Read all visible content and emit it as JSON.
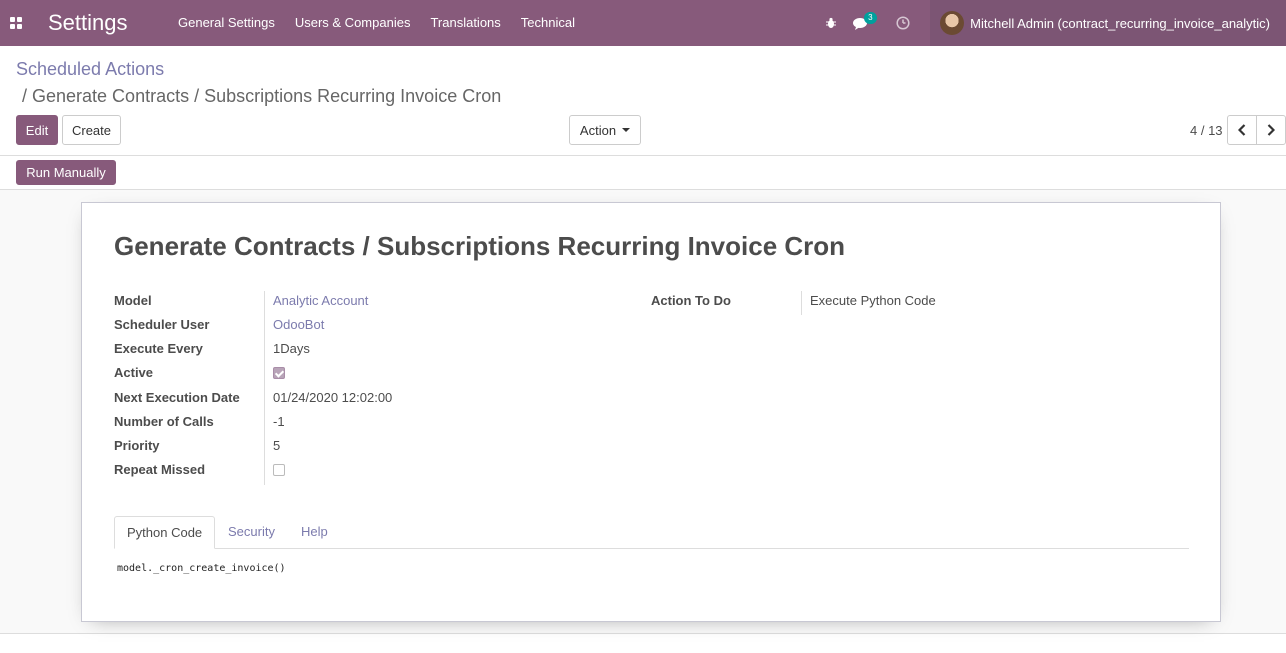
{
  "navbar": {
    "app_title": "Settings",
    "menu": [
      "General Settings",
      "Users & Companies",
      "Translations",
      "Technical"
    ],
    "icons": [
      "apps-icon",
      "bug-icon",
      "chat-icon",
      "clock-icon"
    ],
    "messages_badge": "3",
    "user_name": "Mitchell Admin (contract_recurring_invoice_analytic)",
    "color": "#875a7b"
  },
  "breadcrumb": {
    "parent": "Scheduled Actions",
    "current": "/ Generate Contracts / Subscriptions Recurring Invoice Cron"
  },
  "toolbar": {
    "edit_label": "Edit",
    "create_label": "Create",
    "action_label": "Action",
    "pager": "4 / 13"
  },
  "statusbar": {
    "run_manually_label": "Run Manually"
  },
  "record": {
    "title": "Generate Contracts / Subscriptions Recurring Invoice Cron",
    "fields_left": [
      {
        "label": "Model",
        "value": "Analytic Account",
        "type": "link"
      },
      {
        "label": "Scheduler User",
        "value": "OdooBot",
        "type": "link"
      },
      {
        "label": "Execute Every",
        "value": "1Days",
        "type": "text"
      },
      {
        "label": "Active",
        "value": "checked",
        "type": "checkbox"
      },
      {
        "label": "Next Execution Date",
        "value": "01/24/2020 12:02:00",
        "type": "text"
      },
      {
        "label": "Number of Calls",
        "value": "-1",
        "type": "text"
      },
      {
        "label": "Priority",
        "value": "5",
        "type": "text"
      },
      {
        "label": "Repeat Missed",
        "value": "unchecked",
        "type": "checkbox"
      }
    ],
    "fields_right": [
      {
        "label": "Action To Do",
        "value": "Execute Python Code"
      }
    ]
  },
  "tabs": [
    {
      "label": "Python Code",
      "active": true
    },
    {
      "label": "Security",
      "active": false
    },
    {
      "label": "Help",
      "active": false
    }
  ],
  "python_code": "model._cron_create_invoice()"
}
